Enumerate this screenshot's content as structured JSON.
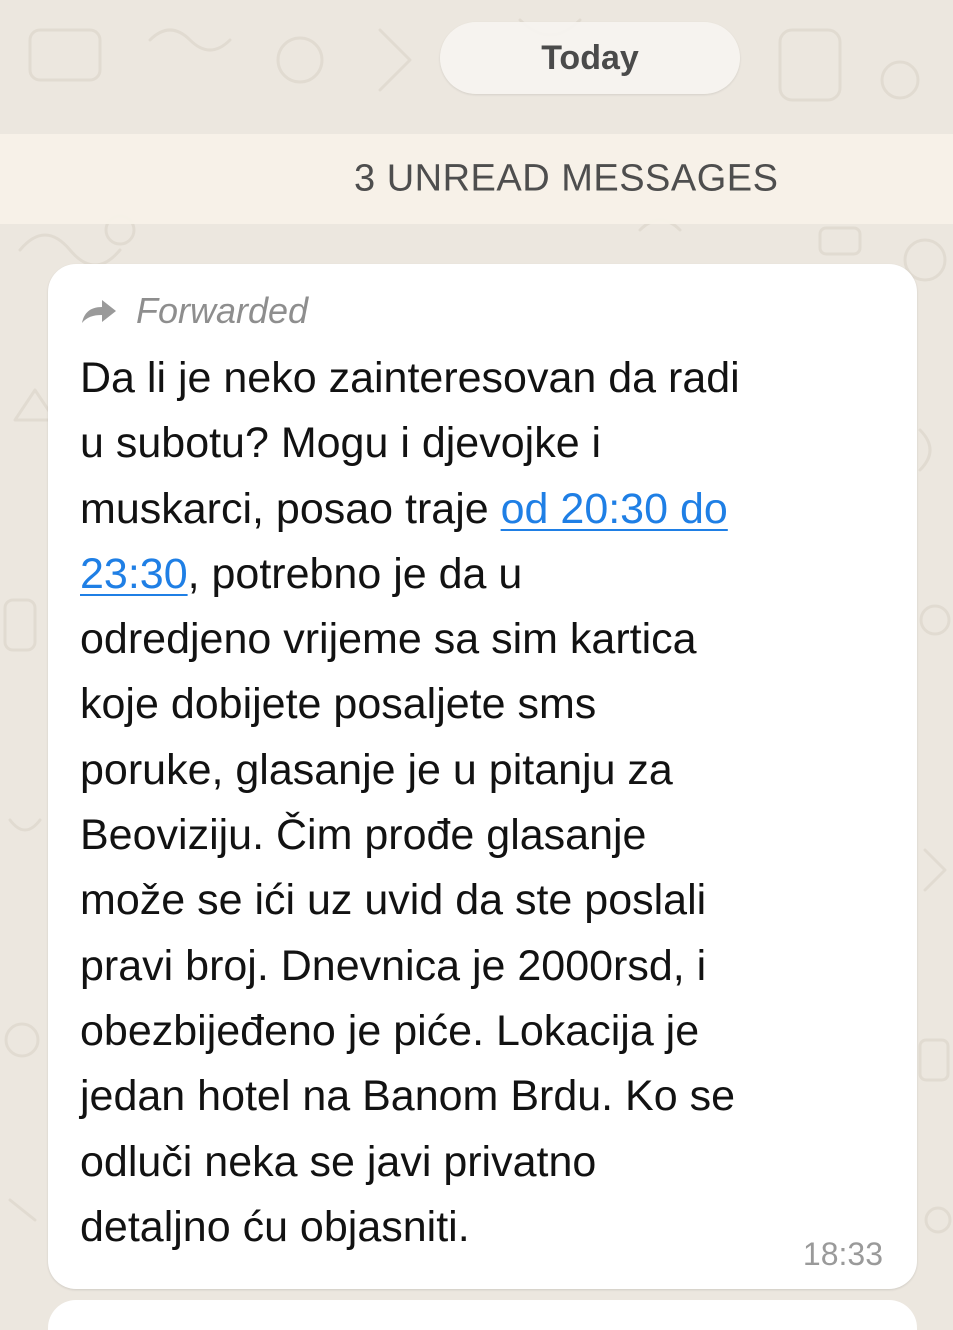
{
  "date_separator": "Today",
  "unread_banner": "3 UNREAD MESSAGES",
  "message": {
    "forwarded_label": "Forwarded",
    "lines": [
      "Da li je neko zainteresovan da radi",
      "u subotu? Mogu i djevojke i",
      "muskarci, posao traje ",
      "",
      "odredjeno vrijeme sa sim kartica",
      "koje dobijete posaljete sms",
      "poruke, glasanje je u pitanju za",
      "Beoviziju. Čim prođe glasanje",
      "može se ići uz uvid da ste poslali",
      "pravi broj. Dnevnica je 2000rsd, i",
      "obezbijeđeno je piće. Lokacija je",
      "jedan hotel na Banom Brdu. Ko se",
      "odluči neka se javi privatno",
      "detaljno ću objasniti."
    ],
    "link_part1": "od 20:30 do",
    "link_part2": "23:30",
    "after_link": ",   potrebno je da u",
    "time": "18:33"
  },
  "colors": {
    "background": "#ece7df",
    "unread_bar": "#f7f1e8",
    "bubble": "#ffffff",
    "link": "#1f7fe5",
    "meta_text": "#8e8e8e"
  },
  "icons": {
    "forwarded": "forward-arrow-icon"
  }
}
